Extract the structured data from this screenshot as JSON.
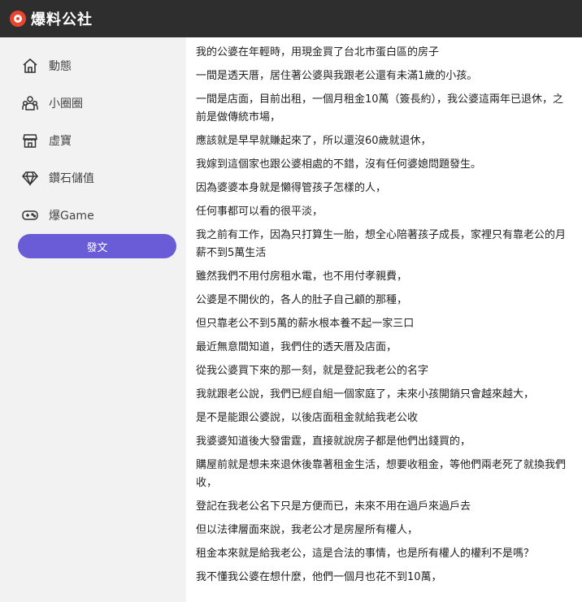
{
  "header": {
    "brand": "爆料公社"
  },
  "sidebar": {
    "items": [
      {
        "label": "動態",
        "icon": "home-icon"
      },
      {
        "label": "小圈圈",
        "icon": "group-icon"
      },
      {
        "label": "虛寶",
        "icon": "store-icon"
      },
      {
        "label": "鑽石儲值",
        "icon": "diamond-icon"
      },
      {
        "label": "爆Game",
        "icon": "gamepad-icon"
      }
    ],
    "post_button": "發文"
  },
  "post": {
    "paragraphs": [
      "我的公婆在年輕時，用現金買了台北市蛋白區的房子",
      "一間是透天厝，居住著公婆與我跟老公還有未滿1歲的小孩。",
      "一間是店面，目前出租，一個月租金10萬（簽長約），我公婆這兩年已退休，之前是做傳統市場，",
      "應該就是早早就賺起來了，所以還沒60歲就退休，",
      "我嫁到這個家也跟公婆相處的不錯，沒有任何婆媳問題發生。",
      "因為婆婆本身就是懶得管孩子怎樣的人，",
      "任何事都可以看的很平淡，",
      "我之前有工作，因為只打算生一胎，想全心陪著孩子成長，家裡只有靠老公的月薪不到5萬生活",
      "雖然我們不用付房租水電，也不用付孝親費，",
      "公婆是不開伙的，各人的肚子自己顧的那種，",
      "但只靠老公不到5萬的薪水根本養不起一家三口",
      "最近無意間知道，我們住的透天厝及店面，",
      "從我公婆買下來的那一刻，就是登記我老公的名字",
      "我就跟老公說，我們已經自組一個家庭了，未來小孩開銷只會越來越大，",
      "是不是能跟公婆說，以後店面租金就給我老公收",
      "我婆婆知道後大發雷霆，直接就說房子都是他們出錢買的，",
      "購屋前就是想未來退休後靠著租金生活，想要收租金，等他們兩老死了就換我們收，",
      "登記在我老公名下只是方便而已，未來不用在過戶來過戶去",
      "但以法律層面來說，我老公才是房屋所有權人，",
      "租金本來就是給我老公，這是合法的事情，也是所有權人的權利不是嗎？",
      "我不懂我公婆在想什麼，他們一個月也花不到10萬，"
    ]
  }
}
